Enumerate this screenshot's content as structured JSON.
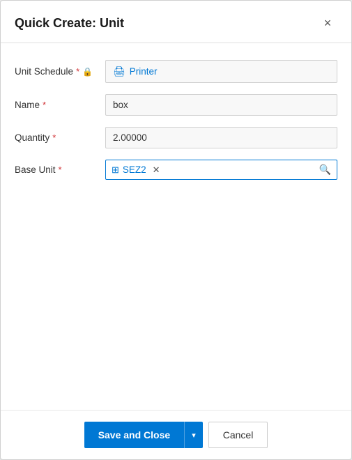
{
  "dialog": {
    "title": "Quick Create: Unit",
    "close_label": "×"
  },
  "form": {
    "unit_schedule": {
      "label": "Unit Schedule",
      "required": true,
      "locked": true,
      "value": "Printer",
      "icon": "printer-icon"
    },
    "name": {
      "label": "Name",
      "required": true,
      "value": "box",
      "placeholder": ""
    },
    "quantity": {
      "label": "Quantity",
      "required": true,
      "value": "2.00000",
      "placeholder": ""
    },
    "base_unit": {
      "label": "Base Unit",
      "required": true,
      "tag_label": "SEZ2",
      "icon": "unit-icon"
    }
  },
  "footer": {
    "save_close_label": "Save and Close",
    "cancel_label": "Cancel"
  }
}
